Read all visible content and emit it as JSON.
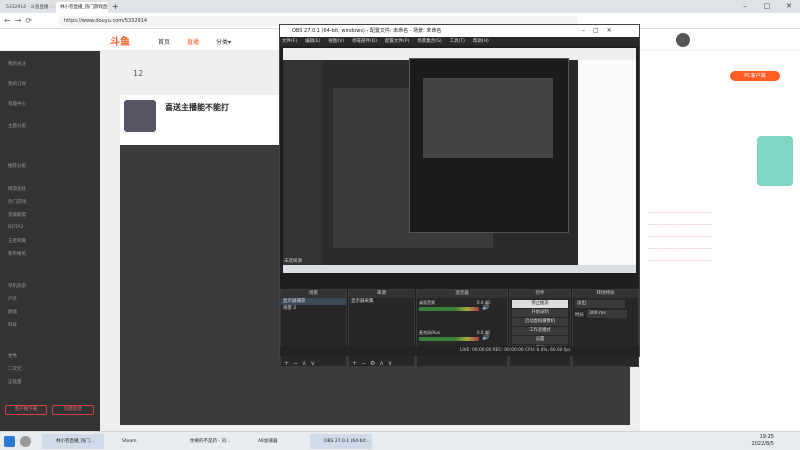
{
  "browser": {
    "tabs": [
      {
        "label": "5332914 - 斗鱼直播 - 斗鱼直..."
      },
      {
        "label": "林小苍直播_热门游戏直播_斗鱼..."
      }
    ],
    "url": "https://www.douyu.com/5332914"
  },
  "site": {
    "logo": "斗鱼",
    "nav": [
      "首页",
      "直播",
      "分类▾"
    ],
    "room": {
      "title": "喜送主播能不能打",
      "follow": "12"
    },
    "sidebar": [
      "我的关注",
      "我的订阅",
      "有趣中心",
      "主题分类",
      "推荐分类",
      "网游竞技",
      "热门游戏",
      "英雄联盟",
      "DOTA2",
      "王者荣耀",
      "和平精英",
      "单机热游",
      "户外",
      "颜值",
      "科技",
      "星秀",
      "二次元",
      "正能量",
      "直播间",
      "鱼乐星天地",
      "娱乐天地",
      "主机游戏",
      "手游"
    ],
    "sidebar_buttons": [
      "客户端下载",
      "问题反馈"
    ],
    "right_badge": "PC客户端"
  },
  "obs": {
    "title": "OBS 27.0.1 (64-bit, windows) - 配置文件: 未命名 - 场景: 未命名",
    "menu": [
      "文件(F)",
      "编辑(E)",
      "视图(V)",
      "停靠部件(D)",
      "配置文件(P)",
      "场景集合(S)",
      "工具(T)",
      "帮助(H)"
    ],
    "preview_label": "未选择源",
    "panels": {
      "scenes": "场景",
      "sources": "来源",
      "mixer": "混音器",
      "controls": "控件",
      "transitions": "转场特效"
    },
    "scenes": [
      "显示器捕获",
      "场景 2"
    ],
    "sources": [
      "显示器采集"
    ],
    "mixer": [
      {
        "name": "桌面音频",
        "level": "0.0 dB"
      },
      {
        "name": "麦克风/Aux",
        "level": "0.0 dB"
      }
    ],
    "controls": [
      "停止推流",
      "开始录制",
      "启动虚拟摄像机",
      "工作室模式",
      "设置",
      "退出"
    ],
    "transition": {
      "type": "淡出",
      "duration_label": "时长",
      "duration": "300 ms"
    },
    "status": "LIVE: 00:00:00   REC: 00:00:00   CPU: 0.4%, 60.00 fps"
  },
  "taskbar": {
    "apps": [
      "林小苍直播_热门...",
      "Steam",
      "你要的不是药 - 刘...",
      "AK加速器",
      "OBS 27.0.1 (64-bit..."
    ],
    "time": "19:25",
    "date": "2022/8/5"
  },
  "colors": {
    "accent": "#ff5d23",
    "obs_bg": "#1f1f1f",
    "taskbar": "#e8ecf1"
  }
}
